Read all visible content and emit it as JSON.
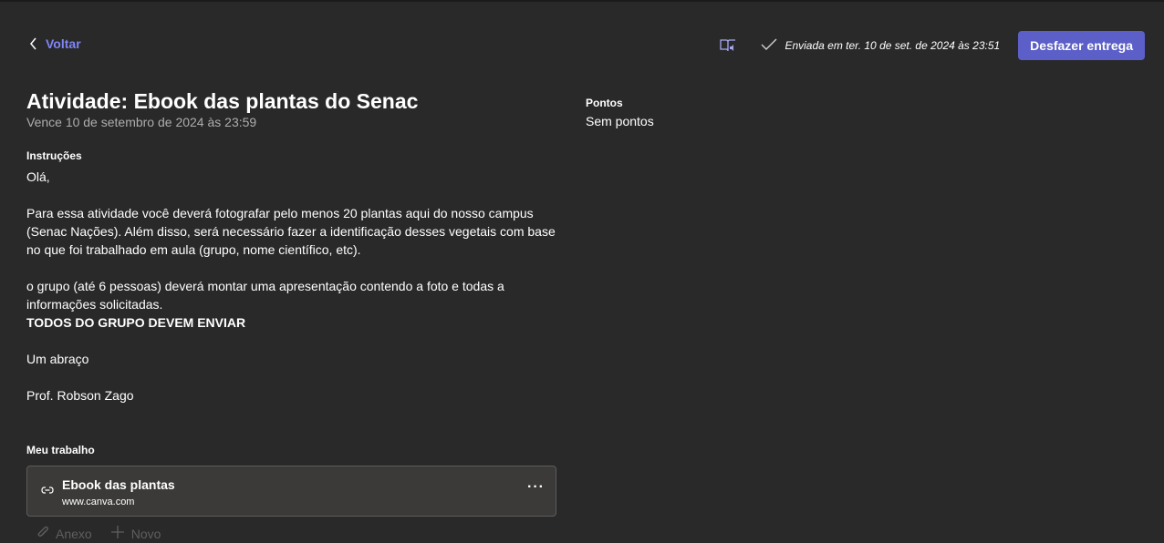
{
  "nav": {
    "back_label": "Voltar"
  },
  "header": {
    "status_text": "Enviada em ter. 10 de set. de 2024 às 23:51",
    "undo_button_label": "Desfazer entrega"
  },
  "assignment": {
    "title": "Atividade: Ebook das plantas do Senac",
    "due": "Vence 10 de setembro de 2024 às 23:59",
    "points_label": "Pontos",
    "points_value": "Sem pontos"
  },
  "instructions": {
    "label": "Instruções",
    "greeting": "Olá,",
    "paragraph1": "Para essa atividade você deverá fotografar pelo menos 20 plantas aqui do nosso campus (Senac Nações). Além disso, será necessário fazer a identificação desses vegetais com base no que foi trabalhado em aula (grupo, nome científico, etc).",
    "paragraph2": "o grupo (até 6 pessoas) deverá montar uma apresentação contendo a foto e todas a informações solicitadas.",
    "emphasis": "TODOS DO GRUPO DEVEM ENVIAR",
    "closing": "Um abraço",
    "signature": "Prof. Robson Zago"
  },
  "my_work": {
    "label": "Meu trabalho",
    "attachment": {
      "title": "Ebook das plantas",
      "url": "www.canva.com",
      "more_label": "···"
    },
    "actions": {
      "attach_label": "Anexo",
      "new_label": "Novo"
    }
  },
  "colors": {
    "background": "#292929",
    "accent": "#5b5fc7",
    "link": "#7f85f5"
  },
  "icons": [
    "chevron-left-icon",
    "immersive-reader-icon",
    "checkmark-icon",
    "link-icon",
    "more-icon",
    "paperclip-icon",
    "plus-icon"
  ]
}
